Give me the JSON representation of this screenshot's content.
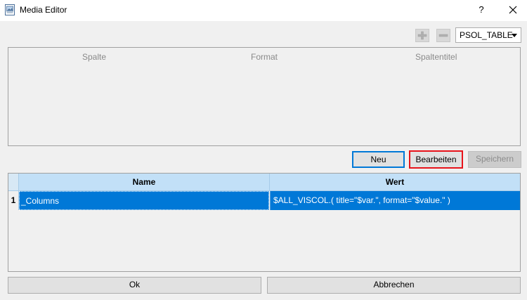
{
  "window": {
    "title": "Media Editor",
    "help_label": "?",
    "close_label": "×"
  },
  "toolbar": {
    "dropdown_value": "PSOL_TABLE"
  },
  "upper_table": {
    "columns": [
      "Spalte",
      "Format",
      "Spaltentitel"
    ]
  },
  "actions": {
    "new_label": "Neu",
    "edit_label": "Bearbeiten",
    "save_label": "Speichern"
  },
  "grid": {
    "columns": [
      "Name",
      "Wert"
    ],
    "rows": [
      {
        "num": "1",
        "name": "_Columns",
        "value": "$ALL_VISCOL.( title=\"$var.\", format=\"$value.\" )",
        "selected": true
      }
    ]
  },
  "footer": {
    "ok_label": "Ok",
    "cancel_label": "Abbrechen"
  },
  "colors": {
    "selection": "#0078d7",
    "highlight_border": "#e8131a",
    "grid_header": "#c2e0f7"
  }
}
